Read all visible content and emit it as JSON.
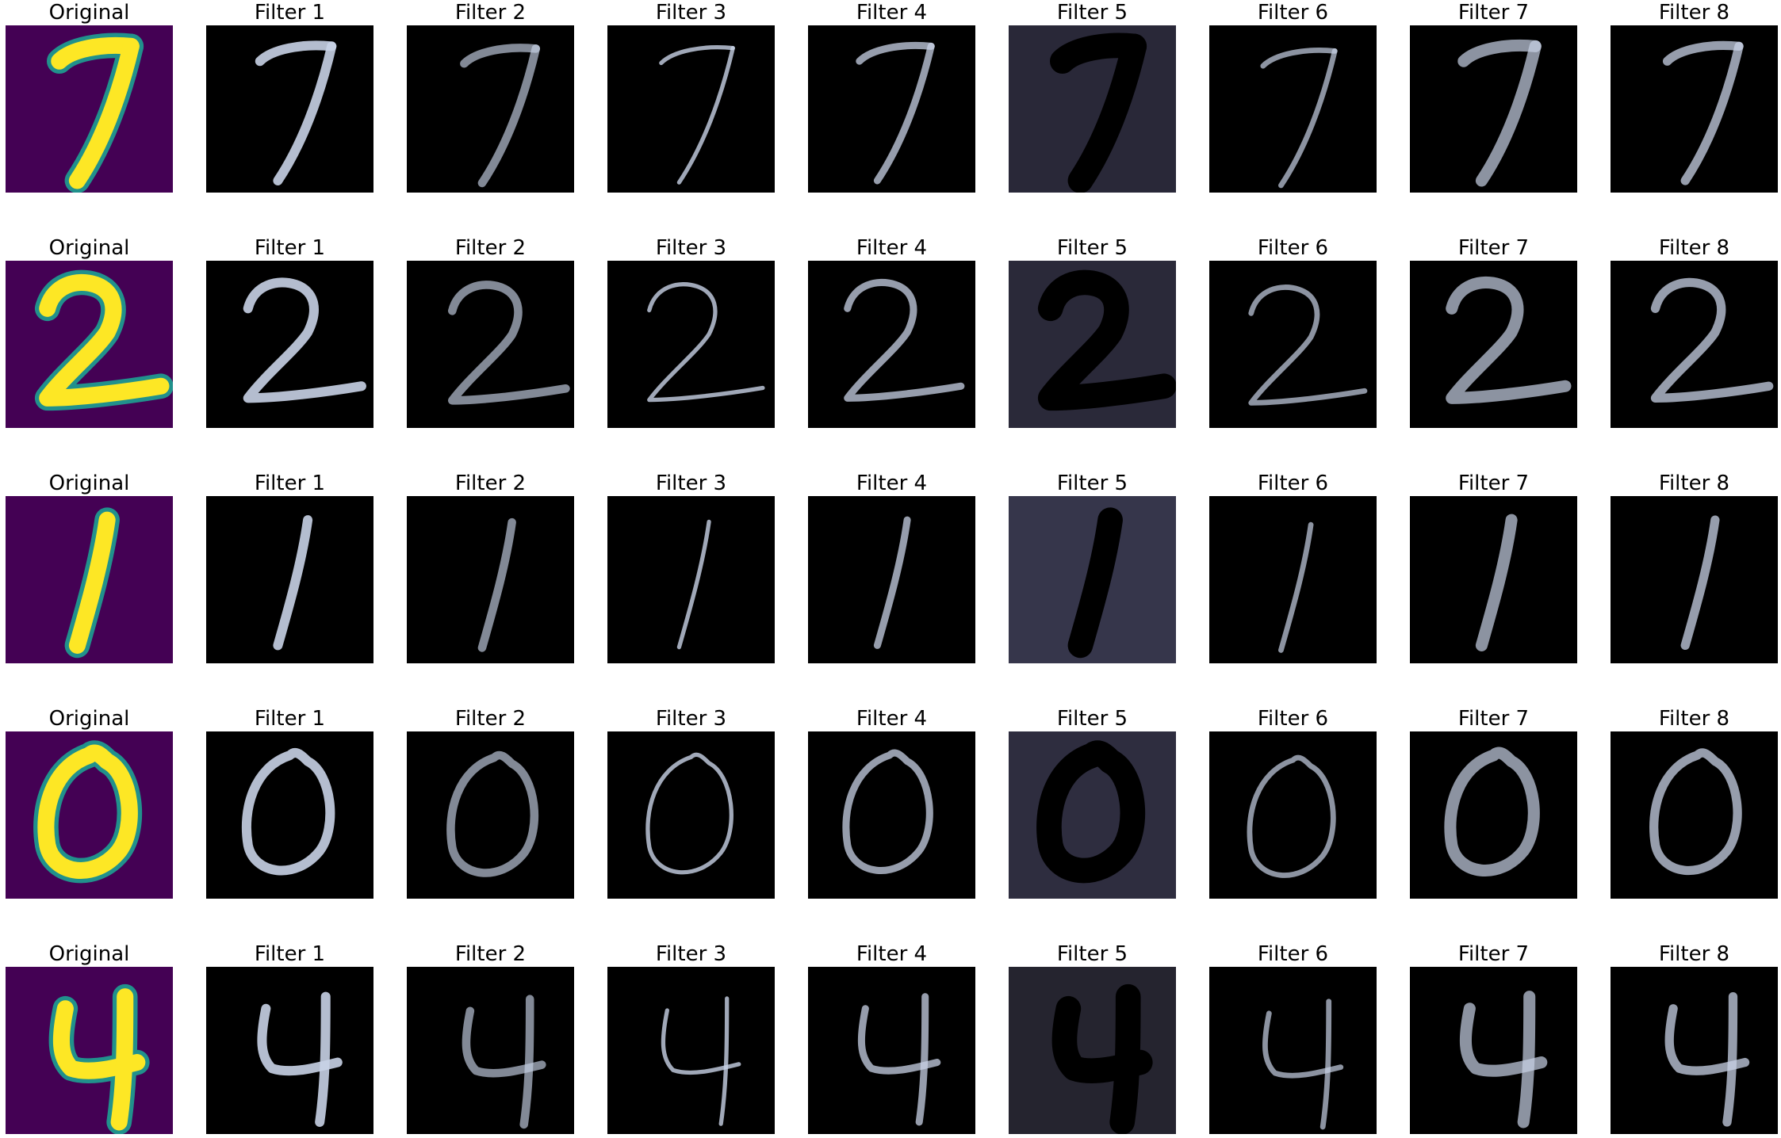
{
  "figure": {
    "column_titles": [
      "Original",
      "Filter 1",
      "Filter 2",
      "Filter 3",
      "Filter 4",
      "Filter 5",
      "Filter 6",
      "Filter 7",
      "Filter 8"
    ],
    "rows": [
      {
        "digit": "7",
        "filter5_background": "#292838"
      },
      {
        "digit": "2",
        "filter5_background": "#2a2939"
      },
      {
        "digit": "1",
        "filter5_background": "#36364b"
      },
      {
        "digit": "0",
        "filter5_background": "#2e2d3f"
      },
      {
        "digit": "4",
        "filter5_background": "#25242f"
      }
    ],
    "colors": {
      "original_background": "#440154",
      "original_stroke": "#fde725",
      "original_halo": "#21918c",
      "feature_background": "#000000",
      "feature_stroke": "#c8d2e6",
      "filter5_stroke": "#000000"
    }
  }
}
